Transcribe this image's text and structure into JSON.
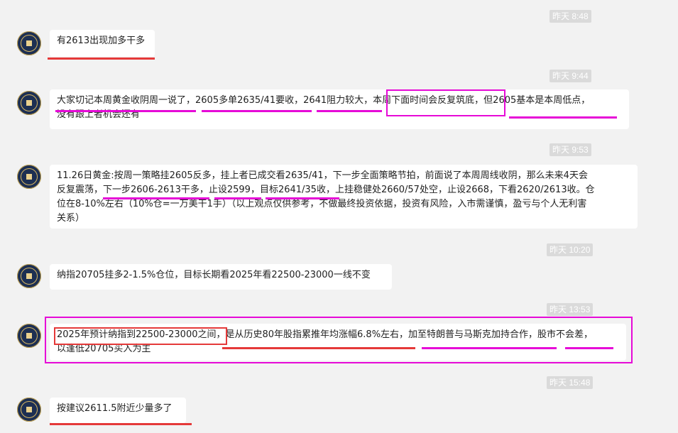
{
  "messages": [
    {
      "time": "昨天 8:48",
      "lines": [
        "有2613出现加多干多"
      ]
    },
    {
      "time": "昨天 9:44",
      "lines": [
        "大家切记本周黄金收阴周一说了，2605多单2635/41要收，2641阻力较大，本周下面时间会反复筑底，但2605基本是本周低点，",
        "没有跟上者机会还有"
      ]
    },
    {
      "time": "昨天 9:53",
      "lines": [
        "11.26日黄金:按周一策略挂2605反多，挂上者已成交看2635/41，下一步全面策略节拍，前面说了本周周线收阴，那么未来4天会",
        "反复震荡，下一步2606-2613干多，止设2599，目标2641/35收，上挂稳健处2660/57处空，止设2668，下看2620/2613收。仓",
        "位在8-10%左右（10%仓=一万美干1手）（以上观点仅供参考，不做最终投资依据，投资有风险，入市需谨慎，盈亏与个人无利害",
        "关系）"
      ]
    },
    {
      "time": "昨天 10:20",
      "lines": [
        "纳指20705挂多2-1.5%仓位，目标长期看2025年看22500-23000一线不变"
      ]
    },
    {
      "time": "昨天 13:53",
      "lines": [
        "2025年预计纳指到22500-23000之间，是从历史80年股指累推年均涨幅6.8%左右，加至特朗普与马斯克加持合作，股市不会差，",
        "以逢低20705买入为主"
      ]
    },
    {
      "time": "昨天 15:48",
      "lines": [
        "按建议2611.5附近少量多了"
      ]
    }
  ],
  "colors": {
    "red_mark": "#e53939",
    "magenta_mark": "#e60ad7",
    "background": "#f2f2f2",
    "bubble": "#ffffff"
  }
}
